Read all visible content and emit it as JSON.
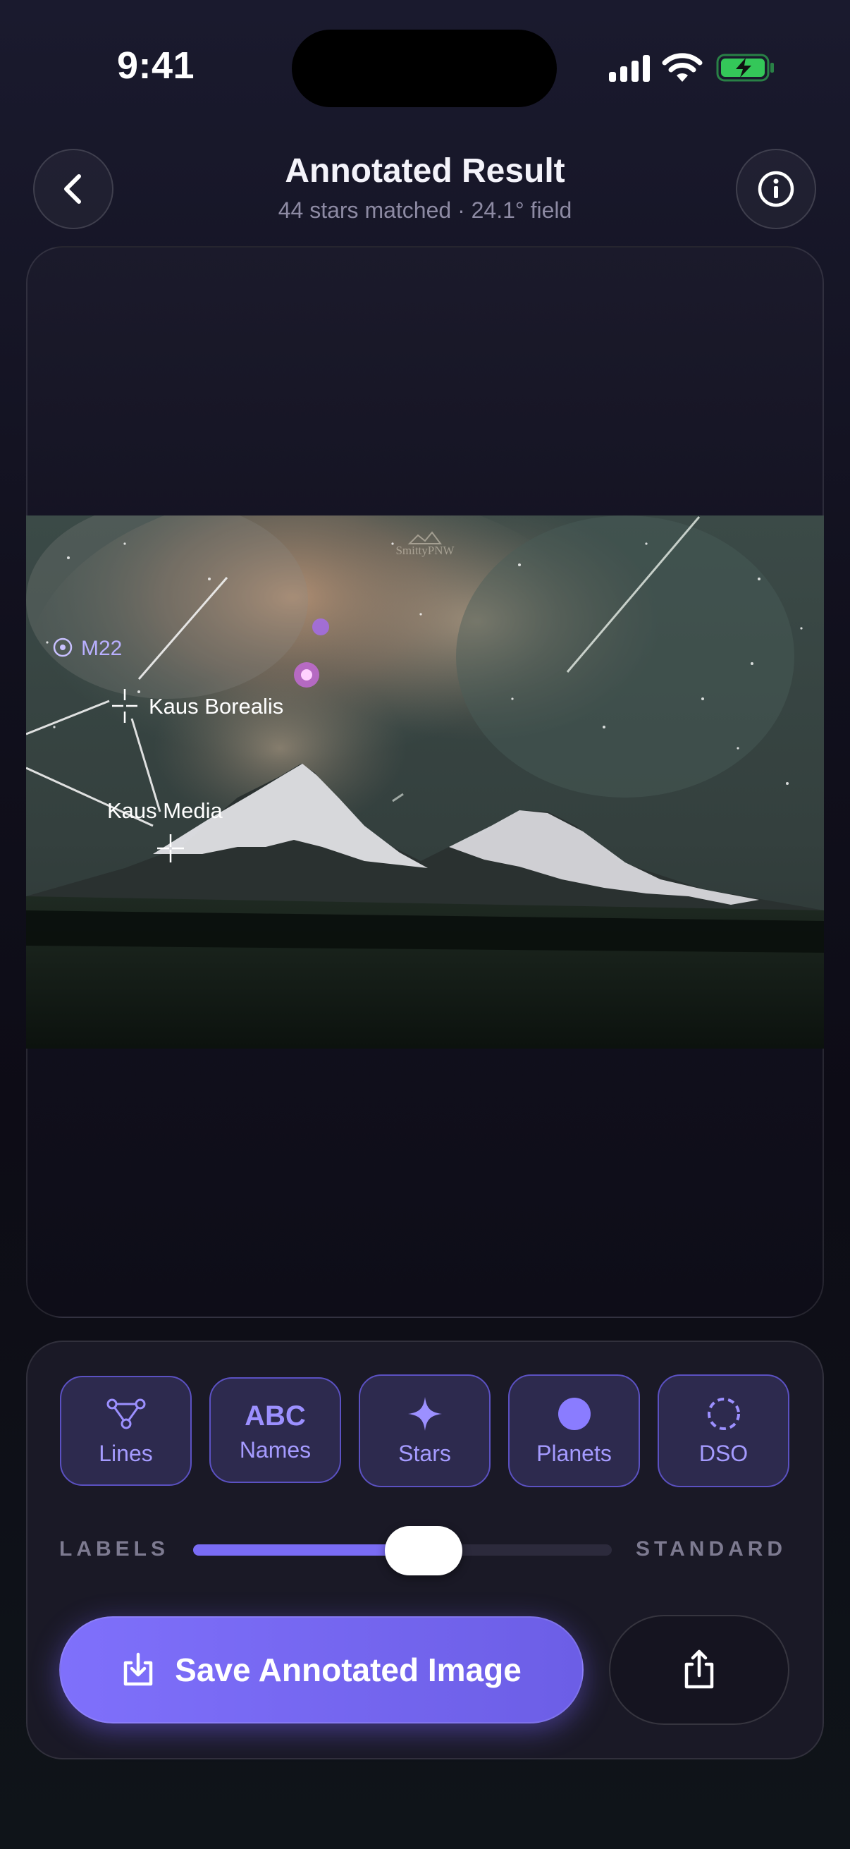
{
  "status_bar": {
    "time": "9:41"
  },
  "header": {
    "title": "Annotated Result",
    "subtitle": "44 stars matched · 24.1° field"
  },
  "photo": {
    "watermark": "SmittyPNW",
    "annotations": {
      "dso": "M22",
      "star_1": "Kaus Borealis",
      "star_2": "Kaus Media"
    }
  },
  "toggles": [
    {
      "label": "Lines",
      "icon": "constellation-lines-icon"
    },
    {
      "label": "Names",
      "icon": "abc-text-icon",
      "icon_text": "ABC"
    },
    {
      "label": "Stars",
      "icon": "sparkle-star-icon"
    },
    {
      "label": "Planets",
      "icon": "filled-circle-icon"
    },
    {
      "label": "DSO",
      "icon": "dashed-circle-icon"
    }
  ],
  "slider": {
    "left_label": "LABELS",
    "right_label": "STANDARD",
    "value": 0.55
  },
  "actions": {
    "save_label": "Save Annotated Image",
    "share_icon": "share-icon"
  },
  "colors": {
    "accent": "#7a6cf4",
    "battery": "#34c759"
  }
}
